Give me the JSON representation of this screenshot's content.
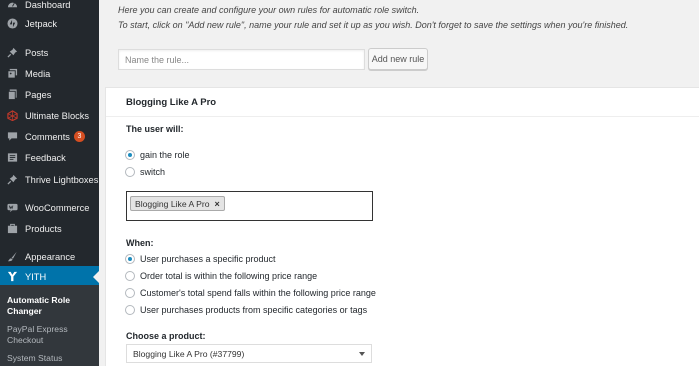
{
  "sidebar": {
    "items": [
      {
        "label": "Dashboard",
        "icon": "dashboard-icon",
        "color": "#9ea3a8"
      },
      {
        "label": "Jetpack",
        "icon": "jetpack-icon",
        "color": "#9ea3a8"
      },
      {
        "label": "Posts",
        "icon": "pin-icon",
        "color": "#9ea3a8"
      },
      {
        "label": "Media",
        "icon": "media-icon",
        "color": "#9ea3a8"
      },
      {
        "label": "Pages",
        "icon": "pages-icon",
        "color": "#9ea3a8"
      },
      {
        "label": "Ultimate Blocks",
        "icon": "ultimate-blocks-icon",
        "color": "#c0392b"
      },
      {
        "label": "Comments",
        "icon": "comments-icon",
        "color": "#9ea3a8",
        "badge": "3"
      },
      {
        "label": "Feedback",
        "icon": "feedback-icon",
        "color": "#9ea3a8"
      },
      {
        "label": "Thrive Lightboxes",
        "icon": "pin-icon",
        "color": "#9ea3a8"
      },
      {
        "label": "WooCommerce",
        "icon": "woocommerce-icon",
        "color": "#9ea3a8"
      },
      {
        "label": "Products",
        "icon": "products-icon",
        "color": "#9ea3a8"
      },
      {
        "label": "Appearance",
        "icon": "appearance-icon",
        "color": "#9ea3a8"
      },
      {
        "label": "YITH",
        "icon": "yith-icon",
        "color": "#ffffff",
        "active": true
      }
    ],
    "submenu": [
      {
        "label": "Automatic Role Changer",
        "current": true
      },
      {
        "label": "PayPal Express Checkout"
      },
      {
        "label": "System Status"
      }
    ]
  },
  "main": {
    "intro_line1": "Here you can create and configure your own rules for automatic role switch.",
    "intro_line2": "To start, click on \"Add new rule\", name your rule and set it up as you wish. Don't forget to save the settings when you're finished.",
    "rule_name_placeholder": "Name the rule...",
    "rule_name_value": "",
    "add_rule_label": "Add new rule",
    "rule": {
      "title": "Blogging Like A Pro",
      "user_will_label": "The user will:",
      "user_will_options": [
        {
          "label": "gain the role",
          "checked": true
        },
        {
          "label": "switch",
          "checked": false
        }
      ],
      "role_tag": "Blogging Like A Pro",
      "role_tag_remove": "×",
      "when_label": "When:",
      "when_options": [
        {
          "label": "User purchases a specific product",
          "checked": true
        },
        {
          "label": "Order total is within the following price range",
          "checked": false
        },
        {
          "label": "Customer's total spend falls within the following price range",
          "checked": false
        },
        {
          "label": "User purchases products from specific categories or tags",
          "checked": false
        }
      ],
      "product_label": "Choose a product:",
      "product_value": "Blogging Like A Pro (#37799)"
    }
  },
  "colors": {
    "sidebar_bg": "#23282d",
    "submenu_bg": "#32373c",
    "accent": "#0073aa",
    "badge": "#d54e21",
    "radio_dot": "#1e8cbe"
  }
}
